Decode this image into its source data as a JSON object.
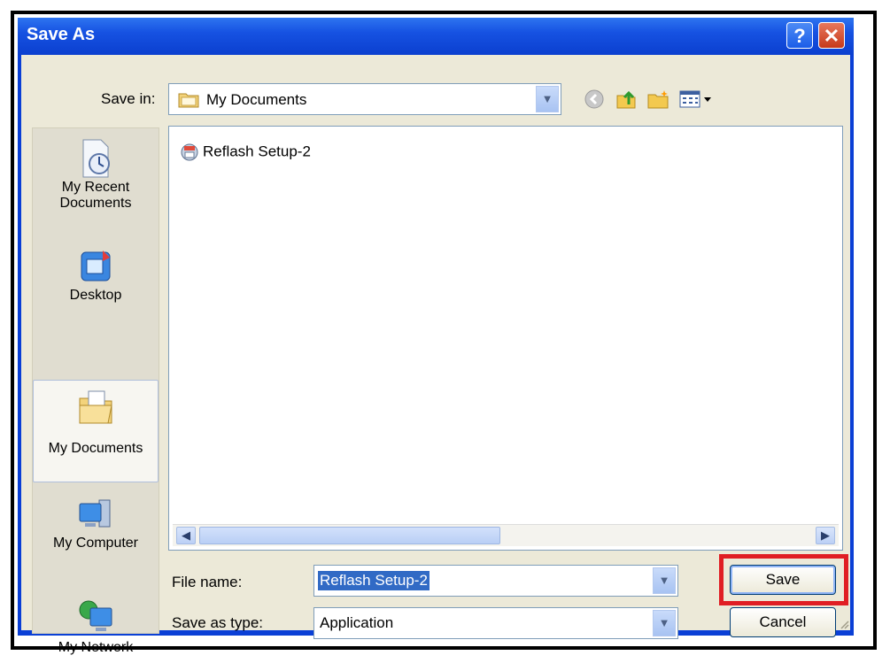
{
  "window": {
    "title": "Save As"
  },
  "titlebar_buttons": {
    "help": "?",
    "close": "✕"
  },
  "save_in": {
    "label": "Save in:",
    "value": "My Documents"
  },
  "toolbar": {
    "icons": [
      "back-icon",
      "up-folder-icon",
      "new-folder-icon",
      "view-menu-icon"
    ]
  },
  "places": [
    {
      "label": "My Recent Documents",
      "icon": "recent-documents-icon"
    },
    {
      "label": "Desktop",
      "icon": "desktop-icon"
    },
    {
      "label": "My Documents",
      "icon": "my-documents-icon",
      "selected": true
    },
    {
      "label": "My Computer",
      "icon": "my-computer-icon"
    },
    {
      "label": "My Network",
      "icon": "my-network-icon"
    }
  ],
  "files": [
    {
      "name": "Reflash Setup-2",
      "icon": "application-icon"
    }
  ],
  "file_name": {
    "label": "File name:",
    "value": "Reflash Setup-2"
  },
  "save_as_type": {
    "label": "Save as type:",
    "value": "Application"
  },
  "buttons": {
    "save": "Save",
    "cancel": "Cancel"
  },
  "colors": {
    "titlebar": "#0b3fcf",
    "selection": "#316ac5",
    "highlight": "#e01e24",
    "dialog_bg": "#ece9d8"
  }
}
